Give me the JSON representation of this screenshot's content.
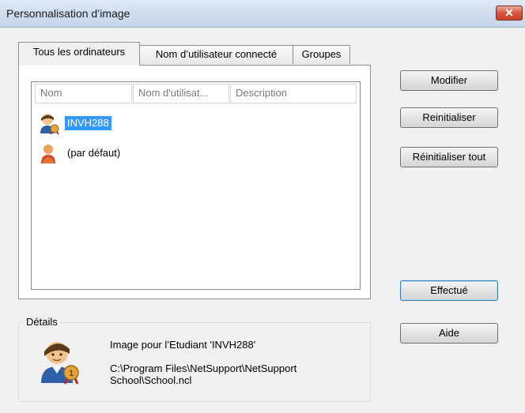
{
  "window": {
    "title": "Personnalisation d’image",
    "close_glyph": "✕"
  },
  "tabs": [
    {
      "label": "Tous les ordinateurs",
      "active": true
    },
    {
      "label": "Nom d’utilisateur connecté",
      "active": false
    },
    {
      "label": "Groupes",
      "active": false
    }
  ],
  "list": {
    "columns": [
      "Nom",
      "Nom d'utilisat...",
      "Description"
    ],
    "items": [
      {
        "label": "INVH288",
        "icon": "student-medal-icon",
        "selected": true
      },
      {
        "label": "(par défaut)",
        "icon": "user-icon",
        "selected": false
      }
    ]
  },
  "buttons": {
    "modifier": "Modifier",
    "reinitialiser": "Reinitialiser",
    "reinitialiser_tout": "Réinitialiser tout",
    "effectue": "Effectué",
    "aide": "Aide"
  },
  "details": {
    "legend": "Détails",
    "icon": "student-medal-icon",
    "line1": "Image pour l’Etudiant 'INVH288'",
    "line2": "C:\\Program Files\\NetSupport\\NetSupport",
    "line3": "School\\School.ncl"
  },
  "colors": {
    "selection": "#3399ff",
    "title_gradient_top": "#dfe9f5",
    "close_red": "#d7553c"
  }
}
